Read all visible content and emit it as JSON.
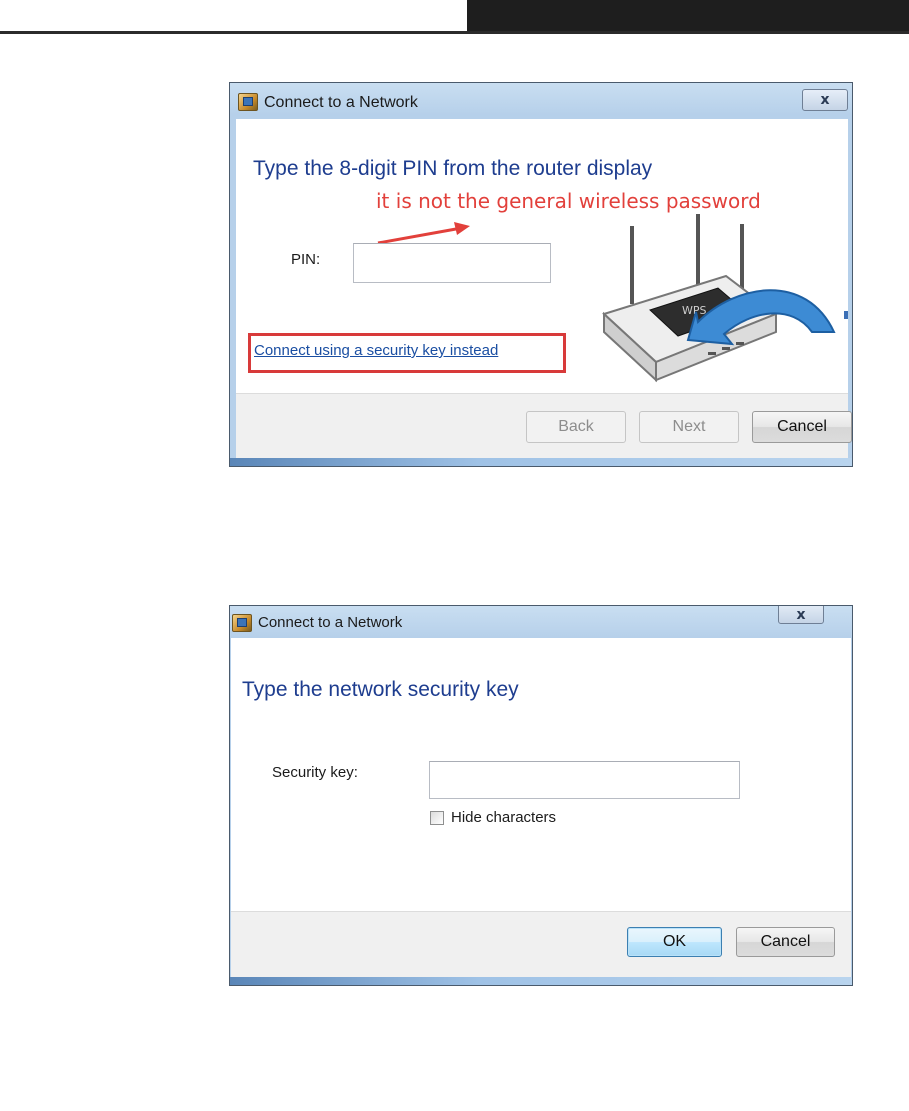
{
  "dialog_pin": {
    "title": "Connect to a Network",
    "close_label": "x",
    "heading": "Type the 8-digit PIN from the router display",
    "annotation": "it is not the general wireless password",
    "pin_label": "PIN:",
    "pin_value": "",
    "router_screen_text": "WPS",
    "link": "Connect using a security key instead",
    "buttons": {
      "back": "Back",
      "next": "Next",
      "cancel": "Cancel"
    }
  },
  "dialog_key": {
    "title": "Connect to a Network",
    "close_label": "x",
    "heading": "Type the network security key",
    "key_label": "Security key:",
    "key_value": "",
    "hide_label": "Hide characters",
    "hide_checked": false,
    "buttons": {
      "ok": "OK",
      "cancel": "Cancel"
    }
  },
  "colors": {
    "heading_blue": "#1e3d8f",
    "annotation_red": "#e2403b",
    "link_blue": "#1a4ea2",
    "frame_blue": "#b6d0ea"
  }
}
